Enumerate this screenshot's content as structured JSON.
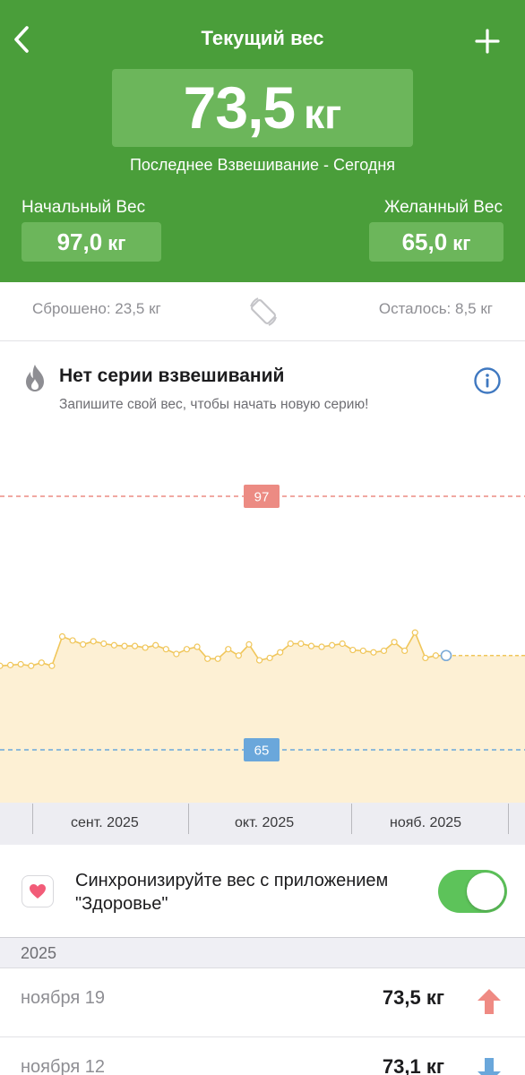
{
  "header": {
    "title": "Текущий вес",
    "current_value": "73,5",
    "current_unit": "кг",
    "last_weigh": "Последнее Взвешивание - Сегодня",
    "start_label": "Начальный Вес",
    "start_value": "97,0",
    "start_unit": "кг",
    "goal_label": "Желанный Вес",
    "goal_value": "65,0",
    "goal_unit": "кг",
    "color": "#4a9e3a",
    "box_color": "#6cb65b"
  },
  "summary": {
    "lost": "Сброшено: 23,5 кг",
    "left": "Осталось: 8,5 кг"
  },
  "streak": {
    "title": "Нет серии взвешиваний",
    "subtitle": "Запишите свой вес, чтобы начать новую серию!"
  },
  "chart_data": {
    "type": "line",
    "start_line": {
      "label": "97",
      "value": 97,
      "color": "#ec8b83"
    },
    "goal_line": {
      "label": "65",
      "value": 65,
      "color": "#6aa7db"
    },
    "x_ticks": [
      "сент. 2025",
      "окт. 2025",
      "нояб. 2025"
    ],
    "line_color": "#f0c65a",
    "fill_color": "#fdf0d4",
    "series": [
      {
        "values": [
          75.6,
          75.7,
          75.8,
          75.6,
          76.0,
          75.6,
          79.3,
          78.8,
          78.3,
          78.7,
          78.4,
          78.2,
          78.1,
          78.1,
          77.9,
          78.2,
          77.7,
          77.1,
          77.7,
          78.0,
          76.5,
          76.5,
          77.7,
          76.9,
          78.3,
          76.3,
          76.6,
          77.3,
          78.4,
          78.4,
          78.1,
          78.0,
          78.2,
          78.4,
          77.6,
          77.5,
          77.3,
          77.5,
          78.6,
          77.5,
          79.8,
          76.6,
          76.9,
          76.9
        ]
      }
    ]
  },
  "sync": {
    "text": "Синхронизируйте вес с приложением \"Здоровье\"",
    "enabled": true,
    "toggle_color": "#5dc35a"
  },
  "history": {
    "year": "2025",
    "entries": [
      {
        "date": "ноября 19",
        "weight": "73,5 кг",
        "trend": "up",
        "color": "#ef8a83"
      },
      {
        "date": "ноября 12",
        "weight": "73,1 кг",
        "trend": "down",
        "color": "#6aa7db"
      }
    ]
  }
}
